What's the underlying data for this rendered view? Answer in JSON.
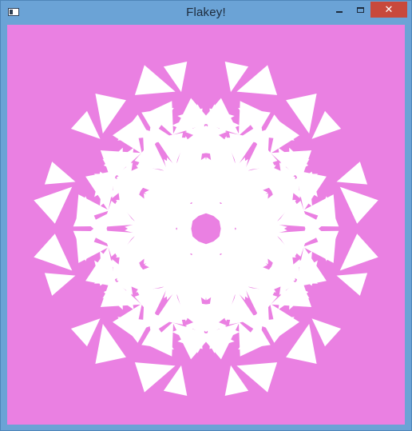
{
  "window": {
    "title": "Flakey!",
    "icon": "app-window-icon",
    "controls": {
      "minimize_icon": "minimize-icon",
      "maximize_icon": "maximize-icon",
      "close_glyph": "✕"
    }
  },
  "canvas": {
    "background_color": "#ea80e2",
    "flake_color": "#ffffff"
  }
}
